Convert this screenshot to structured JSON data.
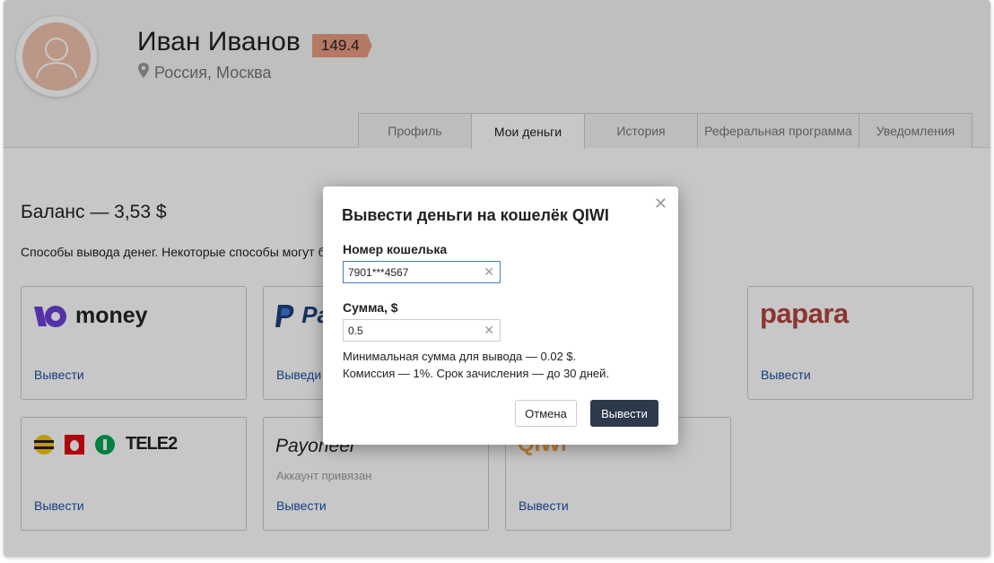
{
  "profile": {
    "name": "Иван Иванов",
    "rating": "149.4",
    "location": "Россия, Москва"
  },
  "tabs": [
    {
      "label": "Профиль"
    },
    {
      "label": "Мои деньги",
      "active": true
    },
    {
      "label": "История"
    },
    {
      "label": "Реферальная программа"
    },
    {
      "label": "Уведомления"
    }
  ],
  "main": {
    "balance": "Баланс — 3,53 $",
    "methods_text": "Способы вывода денег. Некоторые способы могут бы"
  },
  "cards": {
    "yoomoney": {
      "logo": "money",
      "action": "Вывести"
    },
    "paypal": {
      "logo": "Pa",
      "action": "Выведи"
    },
    "papara": {
      "logo": "papara",
      "action": "Вывести"
    },
    "mobile": {
      "logo": "TELE2",
      "action": "Вывести"
    },
    "payoneer": {
      "logo": "Payoneer",
      "status": "Аккаунт привязан",
      "action": "Вывести"
    },
    "qiwi": {
      "logo": "QIWI",
      "action": "Вывести"
    }
  },
  "modal": {
    "title": "Вывести деньги на кошелёк QIWI",
    "wallet_label": "Номер кошелька",
    "wallet_value": "7901***4567",
    "amount_label": "Сумма, $",
    "amount_value": "0.5",
    "hint_line1": "Минимальная сумма для вывода — 0.02 $.",
    "hint_line2": "Комиссия — 1%. Срок зачисления — до 30 дней.",
    "cancel_label": "Отмена",
    "submit_label": "Вывести"
  },
  "colors": {
    "link": "#1f4fa3",
    "submit_button": "#2d3a4b",
    "rating_badge": "#e89a82",
    "input_focus": "#4a78c2"
  },
  "icons": [
    "user-silhouette-icon",
    "location-pin-icon",
    "close-icon",
    "clear-icon"
  ]
}
